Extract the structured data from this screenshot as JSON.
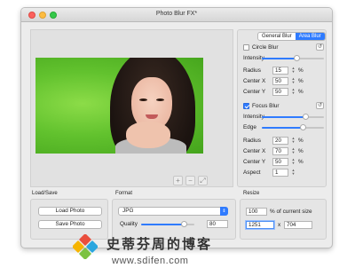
{
  "window": {
    "title": "Photo Blur FX*"
  },
  "tabs": {
    "general": "General Blur",
    "area": "Area Blur"
  },
  "circle_blur": {
    "label": "Circle Blur",
    "checked": false,
    "intensity_label": "Intensity",
    "intensity_level": 0.55,
    "radius_label": "Radius",
    "radius_value": "15",
    "center_x_label": "Center X",
    "center_x_value": "50",
    "center_y_label": "Center Y",
    "center_y_value": "50",
    "unit": "%"
  },
  "focus_blur": {
    "label": "Focus Blur",
    "checked": true,
    "intensity_label": "Intensity",
    "intensity_level": 0.7,
    "edge_label": "Edge",
    "edge_level": 0.65,
    "radius_label": "Radius",
    "radius_value": "20",
    "center_x_label": "Center X",
    "center_x_value": "70",
    "center_y_label": "Center Y",
    "center_y_value": "50",
    "aspect_label": "Aspect",
    "aspect_value": "1",
    "unit": "%"
  },
  "zoom": {
    "in": "+",
    "out": "−",
    "fit": "⤢"
  },
  "load_save": {
    "label": "Load/Save",
    "load": "Load Photo",
    "save": "Save Photo"
  },
  "format": {
    "label": "Format",
    "selected": "JPG",
    "quality_label": "Quality",
    "quality_value": "80",
    "quality_level": 0.8
  },
  "resize": {
    "label": "Resize",
    "percent_value": "100",
    "percent_label": "% of current size",
    "width_value": "1251",
    "times": "x",
    "height_value": "704"
  },
  "watermark": {
    "cn_text": "史蒂芬周的博客",
    "url": "www.sdifen.com"
  },
  "colors": {
    "accent": "#2f7bff"
  }
}
